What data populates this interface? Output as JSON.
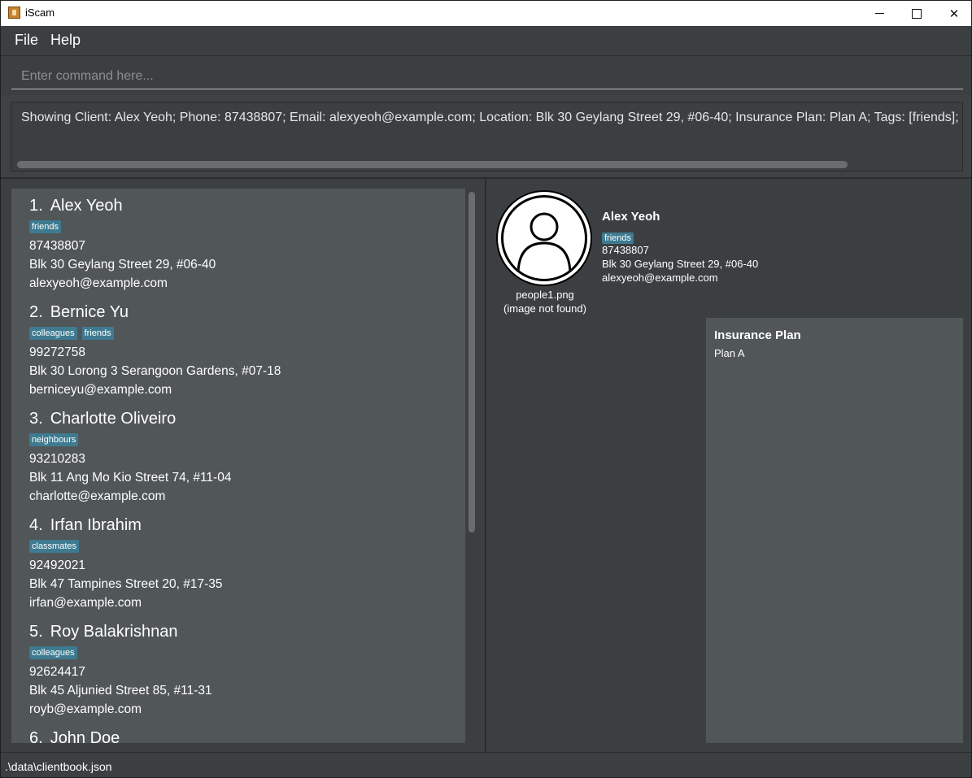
{
  "window": {
    "title": "iScam",
    "icons": {
      "app": "app-icon",
      "minimize": "minimize-icon",
      "maximize": "maximize-icon",
      "close": "close-icon"
    }
  },
  "menu": {
    "file": "File",
    "help": "Help"
  },
  "command": {
    "placeholder": "Enter command here...",
    "value": ""
  },
  "result": {
    "text": "Showing Client: Alex Yeoh; Phone: 87438807; Email: alexyeoh@example.com; Location: Blk 30 Geylang Street 29, #06-40; Insurance Plan: Plan A; Tags: [friends];"
  },
  "clients": [
    {
      "index": "1.",
      "name": "Alex Yeoh",
      "tags": [
        "friends"
      ],
      "phone": "87438807",
      "address": "Blk 30 Geylang Street 29, #06-40",
      "email": "alexyeoh@example.com"
    },
    {
      "index": "2.",
      "name": "Bernice Yu",
      "tags": [
        "colleagues",
        "friends"
      ],
      "phone": "99272758",
      "address": "Blk 30 Lorong 3 Serangoon Gardens, #07-18",
      "email": "berniceyu@example.com"
    },
    {
      "index": "3.",
      "name": "Charlotte Oliveiro",
      "tags": [
        "neighbours"
      ],
      "phone": "93210283",
      "address": "Blk 11 Ang Mo Kio Street 74, #11-04",
      "email": "charlotte@example.com"
    },
    {
      "index": "4.",
      "name": "Irfan Ibrahim",
      "tags": [
        "classmates"
      ],
      "phone": "92492021",
      "address": "Blk 47 Tampines Street 20, #17-35",
      "email": "irfan@example.com"
    },
    {
      "index": "5.",
      "name": "Roy Balakrishnan",
      "tags": [
        "colleagues"
      ],
      "phone": "92624417",
      "address": "Blk 45 Aljunied Street 85, #11-31",
      "email": "royb@example.com"
    },
    {
      "index": "6.",
      "name": "John Doe"
    }
  ],
  "detail": {
    "name": "Alex Yeoh",
    "tag": "friends",
    "phone": "87438807",
    "address": "Blk 30 Geylang Street 29, #06-40",
    "email": "alexyeoh@example.com",
    "image_file": "people1.png",
    "image_status": "(image not found)",
    "plan_title": "Insurance Plan",
    "plan_value": "Plan A"
  },
  "status": {
    "path": ".\\data\\clientbook.json"
  }
}
